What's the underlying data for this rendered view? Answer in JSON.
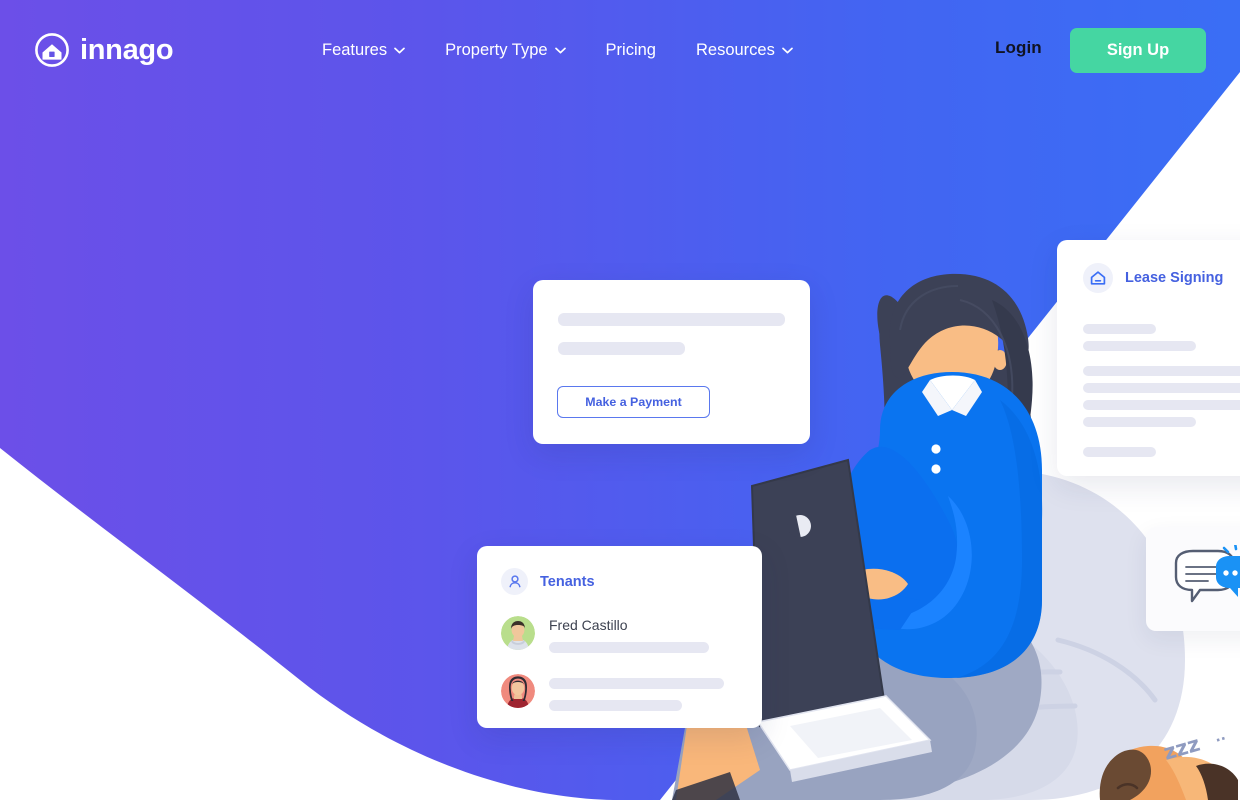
{
  "brand": {
    "name": "innago",
    "logo_icon": "house-in-circle-icon",
    "accent_purple": "#6453E6",
    "accent_blue": "#3A6EF5",
    "accent_green": "#45D6A2",
    "link_blue": "#4561E0"
  },
  "header": {
    "nav": [
      {
        "label": "Features",
        "has_caret": true,
        "icon": "chevron-down-icon"
      },
      {
        "label": "Property Type",
        "has_caret": true,
        "icon": "chevron-down-icon"
      },
      {
        "label": "Pricing",
        "has_caret": false,
        "icon": ""
      },
      {
        "label": "Resources",
        "has_caret": true,
        "icon": "chevron-down-icon"
      }
    ],
    "login_label": "Login",
    "signup_label": "Sign Up"
  },
  "cards": {
    "payment": {
      "button_label": "Make a Payment",
      "placeholder_lines": 2
    },
    "tenants": {
      "title": "Tenants",
      "icon": "person-icon",
      "rows": [
        {
          "name": "Fred Castillo",
          "avatar": "avatar-green",
          "lines": 1
        },
        {
          "name": "",
          "avatar": "avatar-red",
          "lines": 2
        }
      ]
    },
    "lease": {
      "title": "Lease Signing",
      "icon": "home-icon",
      "placeholder_lines": 7
    },
    "chat": {
      "icon": "chat-bubbles-icon"
    }
  },
  "illustration": {
    "subject": "woman-with-laptop",
    "pet": "sleeping-dog",
    "sleep_text": "zzz"
  }
}
